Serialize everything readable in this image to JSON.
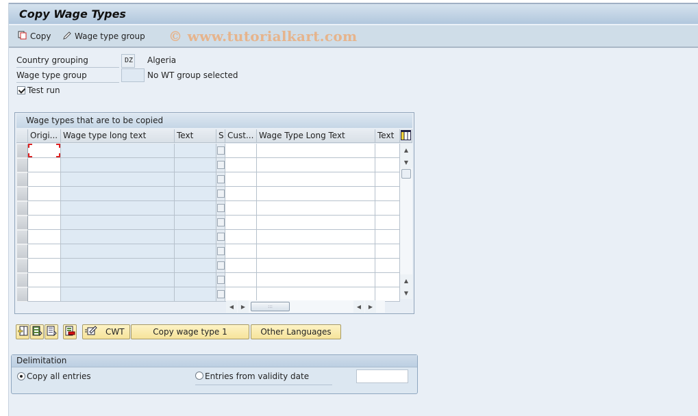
{
  "title": "Copy Wage Types",
  "toolbar": {
    "copy_label": "Copy",
    "wage_type_group_label": "Wage type group",
    "watermark": "© www.tutorialkart.com"
  },
  "form": {
    "country_grouping_label": "Country grouping",
    "country_grouping_value": "DZ",
    "country_grouping_text": "Algeria",
    "wage_type_group_label": "Wage type group",
    "wage_type_group_value": "",
    "wage_type_group_text": "No WT group selected",
    "test_run_label": "Test run",
    "test_run_checked": true
  },
  "table": {
    "caption": "Wage types that are to be copied",
    "columns": [
      "Origi...",
      "Wage type long text",
      "Text",
      "S",
      "Cust...",
      "Wage Type Long Text",
      "Text"
    ],
    "visible_rows": 11,
    "rows": []
  },
  "buttons": {
    "icon_buttons": [
      "insert-row-icon",
      "select-all-icon",
      "deselect-all-icon",
      "delete-row-icon"
    ],
    "cwt_label": "CWT",
    "copy_wage_type_label": "Copy wage type 1",
    "other_languages_label": "Other Languages"
  },
  "delimitation": {
    "title": "Delimitation",
    "option_all_label": "Copy all entries",
    "option_date_label": "Entries from validity date",
    "selected": "all",
    "validity_date_value": ""
  }
}
